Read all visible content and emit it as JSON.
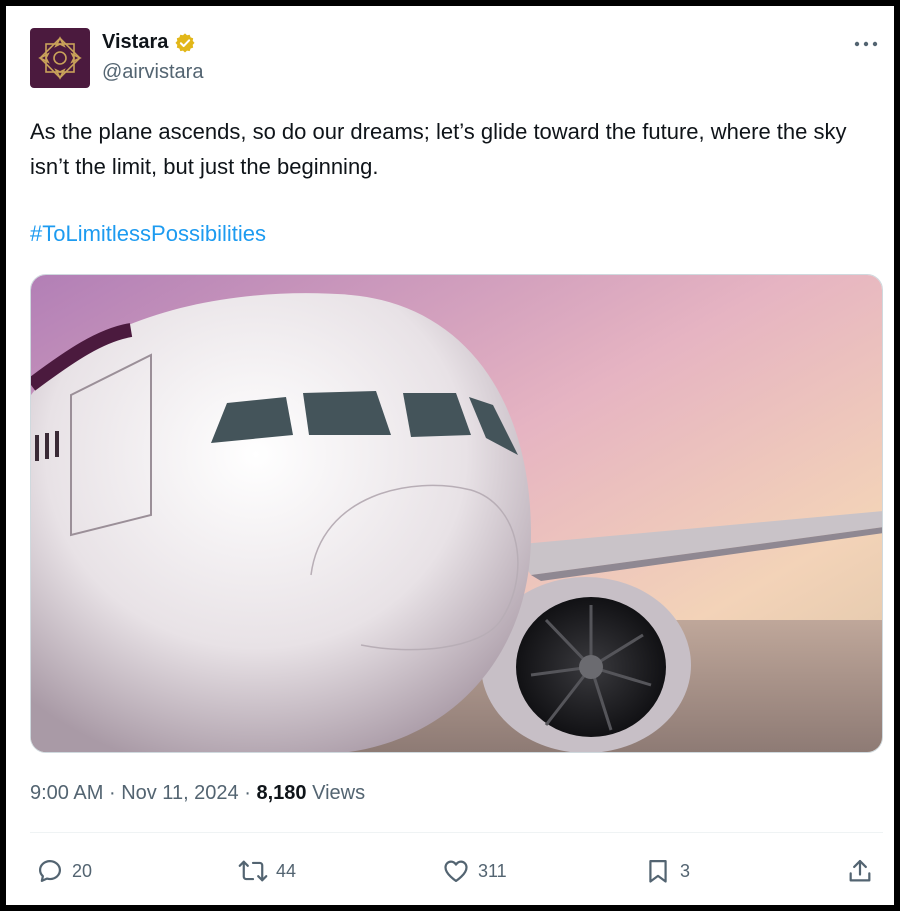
{
  "post": {
    "author_name": "Vistara",
    "author_handle": "@airvistara",
    "text": "As the plane ascends, so do our dreams; let’s glide toward the future, where the sky isn’t the limit, but just the beginning.",
    "hashtag": "#ToLimitlessPossibilities",
    "time": "9:00 AM",
    "separator": "·",
    "date": "Nov 11, 2024",
    "views_count": "8,180",
    "views_label": "Views",
    "media_description_icon": "airplane-photo"
  },
  "actions": {
    "replies": "20",
    "reposts": "44",
    "likes": "311",
    "bookmarks": "3"
  },
  "colors": {
    "accent": "#1d9bf0",
    "verified_badge": "#e2b719",
    "brand_background": "#4b1a3e",
    "brand_gold": "#c9a25a",
    "text_secondary": "#536471"
  }
}
